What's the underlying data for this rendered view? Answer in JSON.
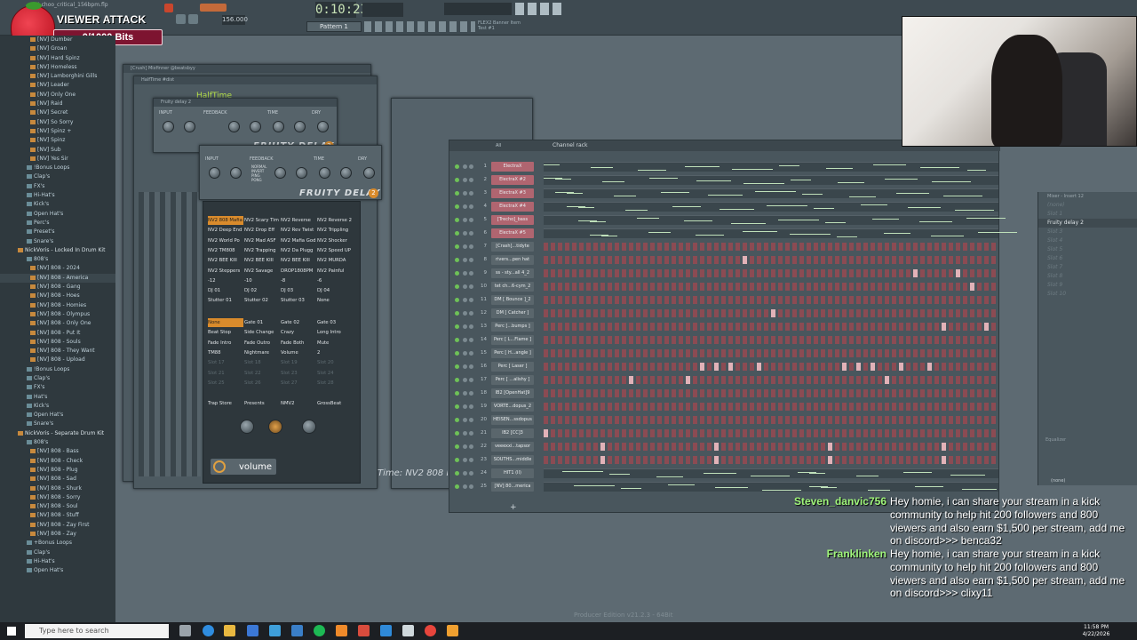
{
  "toolbar": {
    "title": "Tet choo_critical_156bpm.flp",
    "time": "0:10:23",
    "bpm": "156.000",
    "pattern": "Pattern 1",
    "hint_line1": "FLEX2 Banner Item",
    "hint_line2": "Test #1"
  },
  "viewer_attack": {
    "title": "VIEWER ATTACK",
    "bits": "0/1000 Bits"
  },
  "browser": {
    "items": [
      {
        "label": "[NV] Dumber",
        "kind": "item"
      },
      {
        "label": "[NV] Groan",
        "kind": "item"
      },
      {
        "label": "[NV] Hard Spinz",
        "kind": "item"
      },
      {
        "label": "[NV] Homeless",
        "kind": "item"
      },
      {
        "label": "[NV] Lamborghini Gills",
        "kind": "item"
      },
      {
        "label": "[NV] Leader",
        "kind": "item"
      },
      {
        "label": "[NV] Only One",
        "kind": "item"
      },
      {
        "label": "[NV] Raid",
        "kind": "item"
      },
      {
        "label": "[NV] Secret",
        "kind": "item"
      },
      {
        "label": "[NV] So Sorry",
        "kind": "item"
      },
      {
        "label": "[NV] Spinz +",
        "kind": "item"
      },
      {
        "label": "[NV] Spinz",
        "kind": "item"
      },
      {
        "label": "[NV] Sub",
        "kind": "item"
      },
      {
        "label": "[NV] Yes Sir",
        "kind": "item"
      },
      {
        "label": "!Bonus Loops",
        "kind": "sub"
      },
      {
        "label": "Clap's",
        "kind": "sub"
      },
      {
        "label": "FX's",
        "kind": "sub"
      },
      {
        "label": "Hi-Hat's",
        "kind": "sub"
      },
      {
        "label": "Kick's",
        "kind": "sub"
      },
      {
        "label": "Open Hat's",
        "kind": "sub"
      },
      {
        "label": "Perc's",
        "kind": "sub"
      },
      {
        "label": "Preset's",
        "kind": "sub"
      },
      {
        "label": "Snare's",
        "kind": "sub"
      },
      {
        "label": "NickVoris - Locked In Drum Kit",
        "kind": "folder"
      },
      {
        "label": "808's",
        "kind": "sub"
      },
      {
        "label": "[NV] 808 - 2024",
        "kind": "item"
      },
      {
        "label": "[NV] 808 - America",
        "kind": "item"
      },
      {
        "label": "[NV] 808 - Gang",
        "kind": "item"
      },
      {
        "label": "[NV] 808 - Hoes",
        "kind": "item"
      },
      {
        "label": "[NV] 808 - Homies",
        "kind": "item"
      },
      {
        "label": "[NV] 808 - Olympus",
        "kind": "item"
      },
      {
        "label": "[NV] 808 - Only One",
        "kind": "item"
      },
      {
        "label": "[NV] 808 - Put It",
        "kind": "item"
      },
      {
        "label": "[NV] 808 - Souls",
        "kind": "item"
      },
      {
        "label": "[NV] 808 - They Want",
        "kind": "item"
      },
      {
        "label": "[NV] 808 - Upload",
        "kind": "item"
      },
      {
        "label": "!Bonus Loops",
        "kind": "sub"
      },
      {
        "label": "Clap's",
        "kind": "sub"
      },
      {
        "label": "FX's",
        "kind": "sub"
      },
      {
        "label": "Hat's",
        "kind": "sub"
      },
      {
        "label": "Kick's",
        "kind": "sub"
      },
      {
        "label": "Open Hat's",
        "kind": "sub"
      },
      {
        "label": "Snare's",
        "kind": "sub"
      },
      {
        "label": "NickVoris - Separate Drum Kit",
        "kind": "folder"
      },
      {
        "label": "808's",
        "kind": "sub"
      },
      {
        "label": "[NV] 808 - Bass",
        "kind": "item"
      },
      {
        "label": "[NV] 808 - Check",
        "kind": "item"
      },
      {
        "label": "[NV] 808 - Plug",
        "kind": "item"
      },
      {
        "label": "[NV] 808 - Sad",
        "kind": "item"
      },
      {
        "label": "[NV] 808 - Shurk",
        "kind": "item"
      },
      {
        "label": "[NV] 808 - Sorry",
        "kind": "item"
      },
      {
        "label": "[NV] 808 - Soul",
        "kind": "item"
      },
      {
        "label": "[NV] 808 - Stuff",
        "kind": "item"
      },
      {
        "label": "[NV] 808 - Zay First",
        "kind": "item"
      },
      {
        "label": "[NV] 808 - Zay",
        "kind": "item"
      },
      {
        "label": "+Bonus Loops",
        "kind": "sub"
      },
      {
        "label": "Clap's",
        "kind": "sub"
      },
      {
        "label": "Hi-Hat's",
        "kind": "sub"
      },
      {
        "label": "Open Hat's",
        "kind": "sub"
      }
    ]
  },
  "plugins": {
    "win_back1": "[Crush] Mixfinner @beatsbyy",
    "win_back2": "HalfTime #dist",
    "halftime_logo": "HalfTime",
    "delay_title_small": "Fruity delay 2",
    "delay_label": "FRUITY DELAY",
    "delay_version": "2",
    "delay_sections": [
      "INPUT",
      "FEEDBACK",
      "TIME",
      "DRY"
    ],
    "fb_modes": [
      "NORMAL",
      "INVERT",
      "PING",
      "PONG"
    ]
  },
  "effects_grid": {
    "presets": [
      [
        "NV2 808 Mafia",
        "NV2 Scary Tim",
        "NV2 Reverse",
        "NV2 Reverse 2"
      ],
      [
        "NV2 Deep End",
        "NV2 Drop Eff",
        "NV2 Rev Twist",
        "NV2 Trippling"
      ],
      [
        "NV2 World Po",
        "NV2 Mad ASF",
        "NV2 Mafia God",
        "NV2 Shocker"
      ],
      [
        "NV2 TM808",
        "NV2 Trapping",
        "NV2 Da Plugg",
        "NV2 Speed UP"
      ],
      [
        "NV2 BEE KIII",
        "NV2 BEE KIII",
        "NV2 BEE KIII",
        "NV2 MURDA"
      ],
      [
        "NV2 Steppers",
        "NV2 Savage",
        "DROP1808PM",
        "NV2 Painful"
      ],
      [
        "-12",
        "-10",
        "-8",
        "-6"
      ],
      [
        "DJ 01",
        "DJ 02",
        "DJ 03",
        "DJ 04"
      ],
      [
        "Stutter 01",
        "Stutter 02",
        "Stutter 03",
        "None"
      ]
    ],
    "fx": [
      [
        "None",
        "Gate 01",
        "Gate 02",
        "Gate 03"
      ],
      [
        "Beat Stop",
        "Side Change",
        "Crazy",
        "Long Intro"
      ],
      [
        "Fade Intro",
        "Fade Outro",
        "Fade Both",
        "Mute"
      ],
      [
        "TM88",
        "Nightmare",
        "Volume",
        "2"
      ],
      [
        "Slot 17",
        "Slot 18",
        "Slot 19",
        "Slot 20"
      ],
      [
        "Slot 21",
        "Slot 22",
        "Slot 23",
        "Slot 24"
      ],
      [
        "Slot 25",
        "Slot 26",
        "Slot 27",
        "Slot 28"
      ],
      [
        "Trap Store",
        "Presents",
        "NMV2",
        "GrossBeat"
      ]
    ],
    "volume_label": "volume",
    "time_label": "Time: NV2 808 Mafia"
  },
  "channel_rack": {
    "title": "Channel rack",
    "filter": "All",
    "channels": [
      {
        "num": "1",
        "name": "ElectraX",
        "type": "piano"
      },
      {
        "num": "2",
        "name": "ElectraX #2",
        "type": "piano"
      },
      {
        "num": "3",
        "name": "ElectraX #3",
        "type": "piano"
      },
      {
        "num": "4",
        "name": "ElectraX #4",
        "type": "piano"
      },
      {
        "num": "5",
        "name": "[Trecho]_bass",
        "type": "piano"
      },
      {
        "num": "6",
        "name": "ElectraX #5",
        "type": "piano"
      },
      {
        "num": "7",
        "name": "[Crash]...tidyte",
        "type": "steps"
      },
      {
        "num": "8",
        "name": "rivers...pen hat",
        "type": "steps"
      },
      {
        "num": "9",
        "name": "ss - sty...all 4_2",
        "type": "steps"
      },
      {
        "num": "10",
        "name": "tet ch...6-cym_2",
        "type": "steps"
      },
      {
        "num": "11",
        "name": "DM [ Bounce ]_2",
        "type": "steps"
      },
      {
        "num": "12",
        "name": "DM [ Catcher ]",
        "type": "steps"
      },
      {
        "num": "13",
        "name": "Perc [...bumps ]",
        "type": "steps"
      },
      {
        "num": "14",
        "name": "Perc [ L...Flame ]",
        "type": "steps"
      },
      {
        "num": "15",
        "name": "Perc [ H...angle ]",
        "type": "steps"
      },
      {
        "num": "16",
        "name": "Perc [ Laser ]",
        "type": "steps"
      },
      {
        "num": "17",
        "name": "Perc [ ...alishy ]",
        "type": "steps"
      },
      {
        "num": "18",
        "name": "IB2 [OpenHat]9",
        "type": "steps"
      },
      {
        "num": "19",
        "name": "VORTE...dopus_2",
        "type": "steps"
      },
      {
        "num": "20",
        "name": "HEISEN...ssdopus",
        "type": "steps"
      },
      {
        "num": "21",
        "name": "IB2 [CC]3",
        "type": "steps"
      },
      {
        "num": "22",
        "name": "veeexxi...tapsor",
        "type": "steps"
      },
      {
        "num": "23",
        "name": "SOUTHS...middle",
        "type": "steps"
      },
      {
        "num": "24",
        "name": "HIT1 (II)",
        "type": "piano"
      },
      {
        "num": "25",
        "name": "[NV] 80...merica",
        "type": "piano"
      }
    ],
    "hits": {
      "8": [
        14
      ],
      "9": [
        26,
        29
      ],
      "10": [
        30
      ],
      "12": [
        16
      ],
      "13": [
        28,
        31
      ],
      "16": [
        11,
        12,
        13,
        15,
        21,
        22,
        23,
        25,
        27
      ],
      "17": [
        6,
        10,
        24
      ],
      "21": [
        0
      ],
      "22": [
        4,
        12,
        20,
        28
      ],
      "23": [
        4,
        12,
        20,
        28
      ]
    },
    "add_symbol": "+"
  },
  "mixer": {
    "header": "Mixer - Insert 12",
    "slots": [
      "(none)",
      "Slot 1",
      "Fruity delay 2",
      "Slot 3",
      "Slot 4",
      "Slot 5",
      "Slot 6",
      "Slot 7",
      "Slot 8",
      "Slot 9",
      "Slot 10"
    ],
    "equalizer": "Equalizer",
    "none_label": "(none)"
  },
  "chat": [
    {
      "user": "Steven_danvic756",
      "message": "Hey homie, i can share your stream in a kick community to help hit 200 followers and 800 viewers and also earn $1,500 per stream, add me on discord>>> benca32"
    },
    {
      "user": "Franklinken",
      "message": "Hey homie, i can share your stream in a kick community to help hit 200 followers and 800 viewers and also earn $1,500 per stream, add me on discord>>> clixy11"
    }
  ],
  "footer": "Producer Edition v21.2.3 - 64Bit",
  "taskbar": {
    "search_placeholder": "Type here to search",
    "time": "11:58 PM",
    "date": "4/22/2026"
  },
  "colors": {
    "accent": "#d98b2c",
    "chat_user": "#9ff57a",
    "step_off": "#8b4b53",
    "channel_red": "#b06570"
  }
}
